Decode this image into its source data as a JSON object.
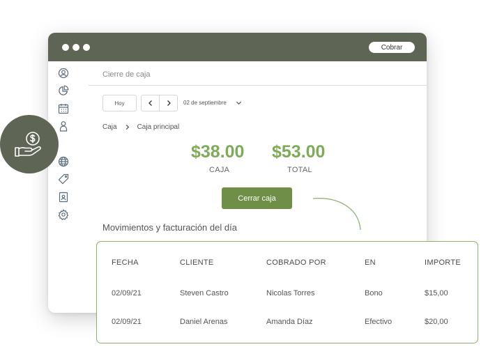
{
  "window": {
    "cobrar_label": "Cobrar"
  },
  "sidebar": {
    "icons": [
      "user-circle-icon",
      "pie-chart-icon",
      "calendar-icon",
      "person-icon",
      "globe-icon",
      "tag-icon",
      "badge-icon",
      "gear-icon"
    ]
  },
  "page": {
    "title": "Cierre de caja",
    "today_label": "Hoy",
    "date_label": "02 de septiembre",
    "breadcrumb": [
      "Caja",
      "Caja principal"
    ],
    "caja_amount": "$38.00",
    "caja_label": "CAJA",
    "total_amount": "$53.00",
    "total_label": "TOTAL",
    "close_button": "Cerrar caja",
    "section_title": "Movimientos y facturación del día"
  },
  "table": {
    "headers": [
      "FECHA",
      "CLIENTE",
      "COBRADO POR",
      "EN",
      "IMPORTE"
    ],
    "rows": [
      [
        "02/09/21",
        "Steven Castro",
        "Nicolas Torres",
        "Bono",
        "$15,00"
      ],
      [
        "02/09/21",
        "Daniel Arenas",
        "Amanda Díaz",
        "Efectivo",
        "$20,00"
      ]
    ]
  },
  "colors": {
    "titlebar": "#5f6554",
    "accent_green": "#7dab57",
    "button_green": "#6e8f45",
    "card_border": "#8ab06a"
  }
}
